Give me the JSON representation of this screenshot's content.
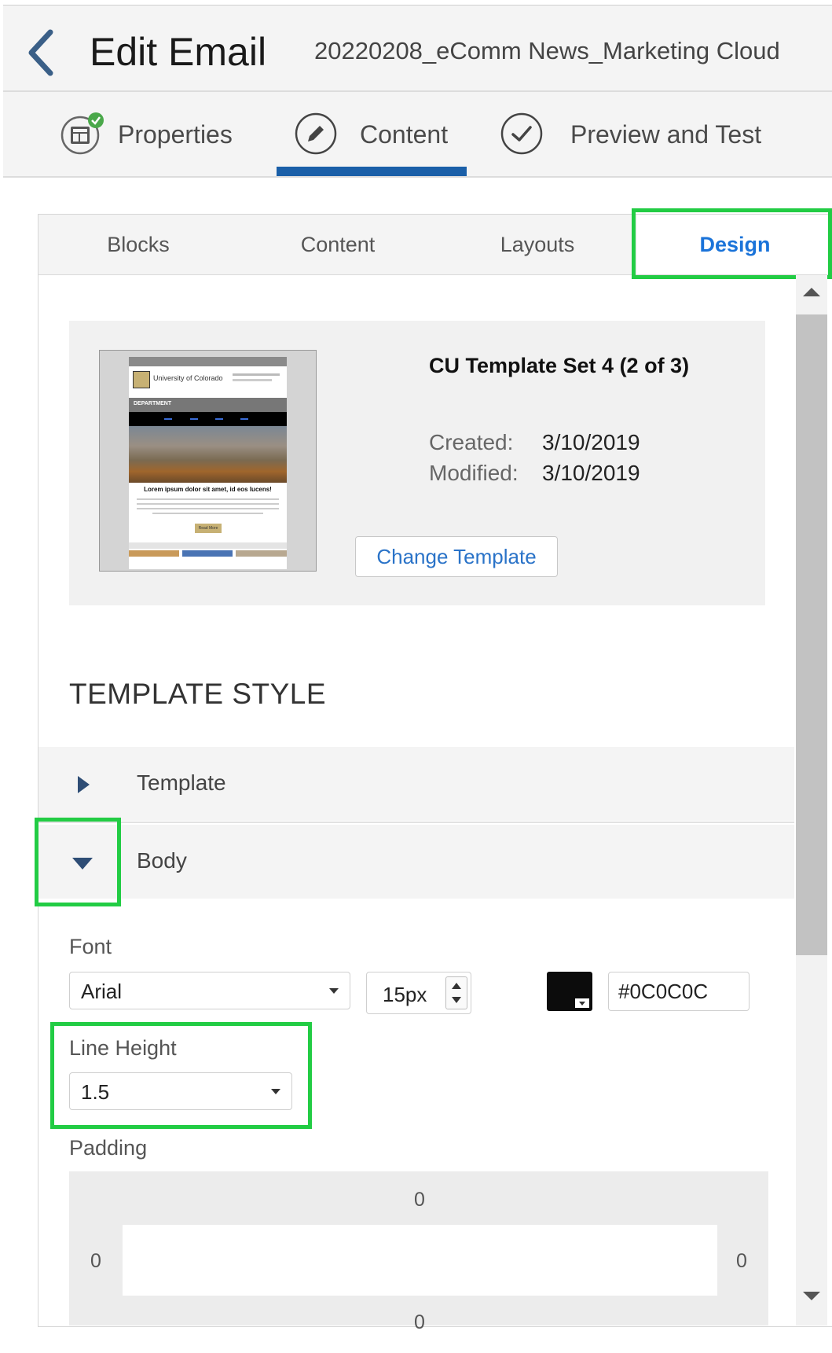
{
  "header": {
    "back_icon": "chevron-left-icon",
    "title": "Edit Email",
    "email_name": "20220208_eComm News_Marketing Cloud"
  },
  "steps": [
    {
      "label": "Properties",
      "icon": "properties-icon-with-green-check"
    },
    {
      "label": "Content",
      "icon": "pencil-icon",
      "active": true
    },
    {
      "label": "Preview and Test",
      "icon": "check-circle-icon"
    }
  ],
  "tabs": {
    "blocks": "Blocks",
    "content": "Content",
    "layouts": "Layouts",
    "design": "Design",
    "active": "Design"
  },
  "template": {
    "name": "CU Template Set 4 (2 of 3)",
    "created_label": "Created:",
    "created_value": "3/10/2019",
    "modified_label": "Modified:",
    "modified_value": "3/10/2019",
    "change_button": "Change Template",
    "thumb": {
      "logo_text": "University of Colorado",
      "department": "DEPARTMENT",
      "headline": "Lorem ipsum dolor sit amet, id eos lucens!",
      "button": "Read More"
    }
  },
  "section_title": "TEMPLATE STYLE",
  "accordion": [
    {
      "label": "Template",
      "expanded": false
    },
    {
      "label": "Body",
      "expanded": true
    }
  ],
  "body": {
    "font_label": "Font",
    "font_value": "Arial",
    "font_size": "15px",
    "color_hex": "#0C0C0C",
    "line_height_label": "Line Height",
    "line_height_value": "1.5",
    "padding_label": "Padding",
    "padding": {
      "top": "0",
      "left": "0",
      "right": "0",
      "bottom": "0"
    }
  },
  "colors": {
    "accent_blue": "#1a73d9",
    "step_underline": "#1a5fa8",
    "highlight_green": "#22cc44",
    "swatch": "#0c0c0c"
  }
}
